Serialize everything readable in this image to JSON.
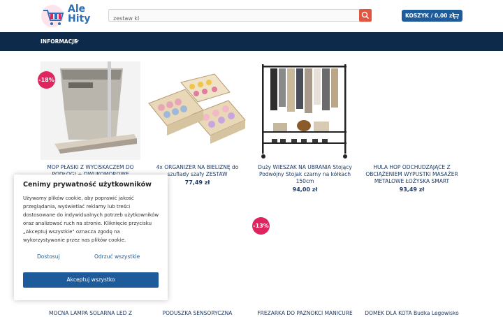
{
  "header": {
    "logo_line1": "Ale",
    "logo_line2": "Hity",
    "search_value": "zestaw kl",
    "cart_label": "KOSZYK / 0,00 zł"
  },
  "nav": {
    "item": "INFORMACJE"
  },
  "products": [
    {
      "title": "MOP PŁASKI Z WYCISKACZEM DO PODŁOGI + DWUKOMOROWE",
      "price": "",
      "badge": "-18%"
    },
    {
      "title": "4x ORGANIZER NA BIELIZNĘ do szuflady szafy ZESTAW",
      "price": "77,49 zł",
      "badge": ""
    },
    {
      "title": "Duży WIESZAK NA UBRANIA Stojący Podwójny Stojak czarny na kółkach 150cm",
      "price": "94,00 zł",
      "badge": ""
    },
    {
      "title": "HULA HOP ODCHUDZAJĄCE Z OBCIĄŻENIEM WYPUSTKI MASAŻER METALOWE ŁOŻYSKA SMART",
      "price": "93,49 zł",
      "badge": ""
    }
  ],
  "row2": {
    "badge": "-13%",
    "titles": [
      "MOCNA LAMPA SOLARNA LED Z",
      "PODUSZKA SENSORYCZNA",
      "FREZARKA DO PAZNOKCI MANICURE",
      "DOMEK DLA KOTA Budka Legowisko"
    ]
  },
  "cookie": {
    "title": "Cenimy prywatność użytkowników",
    "text": "Używamy plików cookie, aby poprawić jakość przeglądania, wyświetlać reklamy lub treści dostosowane do indywidualnych potrzeb użytkowników oraz analizować ruch na stronie. Kliknięcie przycisku „Akceptuj wszystkie\" oznacza zgodę na wykorzystywanie przez nas plików cookie.",
    "customize": "Dostosuj",
    "reject": "Odrzuć wszystkie",
    "accept": "Akceptuj wszystko"
  },
  "colors": {
    "nav_bg": "#0d2a4a",
    "accent_blue": "#1d5b9a",
    "search_btn": "#e2563f",
    "badge": "#e0245e"
  },
  "icons": [
    "cart-logo-icon",
    "search-icon",
    "cart-icon",
    "chevron-down-icon"
  ]
}
